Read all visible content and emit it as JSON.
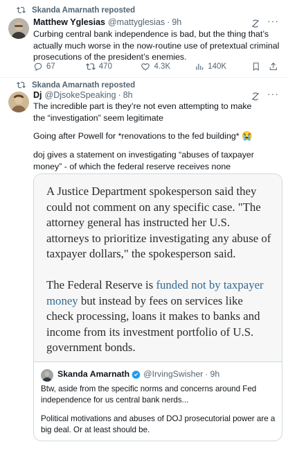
{
  "tweet1": {
    "repost_label": "Skanda Amarnath reposted",
    "name": "Matthew Yglesias",
    "handle": "@mattyglesias",
    "time": "9h",
    "text": "Curbing central bank independence is bad, but the thing that’s actually much worse in the now-routine use of pretextual criminal prosecutions of the president’s enemies.",
    "replies": "67",
    "reposts": "470",
    "likes": "4.3K",
    "views": "140K"
  },
  "tweet2": {
    "repost_label": "Skanda Amarnath reposted",
    "name": "Dj",
    "handle": "@DjsokeSpeaking",
    "time": "8h",
    "text_line1": "The incredible part is they’re not even attempting to make the “investigation” seem legitimate",
    "text_line2": "Going after Powell for *renovations to the fed building* 😭",
    "text_line3": "doj gives a statement on investigating “abuses of taxpayer money” - of which the federal reserve receives none",
    "article": {
      "para1": "A Justice Department spokesperson said they could not comment on any specific case. \"The attorney general has instructed her U.S. attorneys to prioritize investigating any abuse of taxpayer dollars,\" the spokesperson said.",
      "para2_prefix": "The Federal Reserve is ",
      "para2_link": "funded not by taxpayer money",
      "para2_suffix": " but instead by fees on services like check processing, loans it makes to banks and income from its investment portfolio of U.S. government bonds."
    },
    "quote": {
      "name": "Skanda Amarnath",
      "handle": "@IrvingSwisher",
      "time": "9h",
      "text_line1": "Btw, aside from the specific norms and concerns around Fed independence for us central bank nerds...",
      "text_line2": "Political motivations and abuses of DOJ prosecutorial power are a big deal. Or at least should be."
    }
  },
  "separator": "·",
  "colors": {
    "text": "#0f1419",
    "muted": "#536471",
    "link": "#326891",
    "verified": "#1d9bf0",
    "border": "#cfd9de"
  }
}
